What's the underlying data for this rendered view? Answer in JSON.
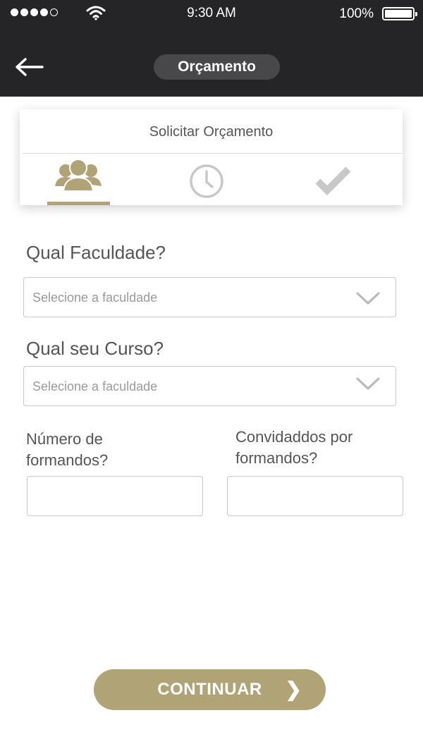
{
  "status_bar": {
    "time": "9:30 AM",
    "battery_percent": "100%",
    "signal_icon": "signal-dots-icon",
    "wifi_icon": "wifi-icon",
    "battery_icon": "battery-icon"
  },
  "header": {
    "title": "Orçamento",
    "back_icon": "arrow-left-icon",
    "background": "#252528"
  },
  "steps_card": {
    "title": "Solicitar Orçamento",
    "steps": [
      {
        "icon": "people-icon",
        "active": true
      },
      {
        "icon": "clock-icon",
        "active": false
      },
      {
        "icon": "checkmark-icon",
        "active": false
      }
    ],
    "accent": "#b0a477"
  },
  "form": {
    "faculdade_label": "Qual Faculdade?",
    "faculdade_placeholder": "Selecione a faculdade",
    "curso_label": "Qual seu Curso?",
    "curso_placeholder": "Selecione a faculdade",
    "formandos_label": "Número de formandos?",
    "convidados_label": "Convidaddos por formandos?",
    "formandos_value": "",
    "convidados_value": ""
  },
  "continue_button": {
    "label": "CONTINUAR",
    "arrow": "❯",
    "color": "#b0a477"
  }
}
